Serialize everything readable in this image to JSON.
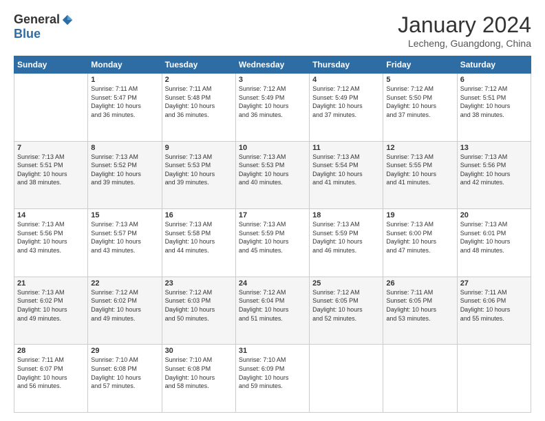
{
  "logo": {
    "general": "General",
    "blue": "Blue"
  },
  "title": "January 2024",
  "location": "Lecheng, Guangdong, China",
  "days_of_week": [
    "Sunday",
    "Monday",
    "Tuesday",
    "Wednesday",
    "Thursday",
    "Friday",
    "Saturday"
  ],
  "weeks": [
    [
      {
        "day": "",
        "info": ""
      },
      {
        "day": "1",
        "info": "Sunrise: 7:11 AM\nSunset: 5:47 PM\nDaylight: 10 hours\nand 36 minutes."
      },
      {
        "day": "2",
        "info": "Sunrise: 7:11 AM\nSunset: 5:48 PM\nDaylight: 10 hours\nand 36 minutes."
      },
      {
        "day": "3",
        "info": "Sunrise: 7:12 AM\nSunset: 5:49 PM\nDaylight: 10 hours\nand 36 minutes."
      },
      {
        "day": "4",
        "info": "Sunrise: 7:12 AM\nSunset: 5:49 PM\nDaylight: 10 hours\nand 37 minutes."
      },
      {
        "day": "5",
        "info": "Sunrise: 7:12 AM\nSunset: 5:50 PM\nDaylight: 10 hours\nand 37 minutes."
      },
      {
        "day": "6",
        "info": "Sunrise: 7:12 AM\nSunset: 5:51 PM\nDaylight: 10 hours\nand 38 minutes."
      }
    ],
    [
      {
        "day": "7",
        "info": "Sunrise: 7:13 AM\nSunset: 5:51 PM\nDaylight: 10 hours\nand 38 minutes."
      },
      {
        "day": "8",
        "info": "Sunrise: 7:13 AM\nSunset: 5:52 PM\nDaylight: 10 hours\nand 39 minutes."
      },
      {
        "day": "9",
        "info": "Sunrise: 7:13 AM\nSunset: 5:53 PM\nDaylight: 10 hours\nand 39 minutes."
      },
      {
        "day": "10",
        "info": "Sunrise: 7:13 AM\nSunset: 5:53 PM\nDaylight: 10 hours\nand 40 minutes."
      },
      {
        "day": "11",
        "info": "Sunrise: 7:13 AM\nSunset: 5:54 PM\nDaylight: 10 hours\nand 41 minutes."
      },
      {
        "day": "12",
        "info": "Sunrise: 7:13 AM\nSunset: 5:55 PM\nDaylight: 10 hours\nand 41 minutes."
      },
      {
        "day": "13",
        "info": "Sunrise: 7:13 AM\nSunset: 5:56 PM\nDaylight: 10 hours\nand 42 minutes."
      }
    ],
    [
      {
        "day": "14",
        "info": "Sunrise: 7:13 AM\nSunset: 5:56 PM\nDaylight: 10 hours\nand 43 minutes."
      },
      {
        "day": "15",
        "info": "Sunrise: 7:13 AM\nSunset: 5:57 PM\nDaylight: 10 hours\nand 43 minutes."
      },
      {
        "day": "16",
        "info": "Sunrise: 7:13 AM\nSunset: 5:58 PM\nDaylight: 10 hours\nand 44 minutes."
      },
      {
        "day": "17",
        "info": "Sunrise: 7:13 AM\nSunset: 5:59 PM\nDaylight: 10 hours\nand 45 minutes."
      },
      {
        "day": "18",
        "info": "Sunrise: 7:13 AM\nSunset: 5:59 PM\nDaylight: 10 hours\nand 46 minutes."
      },
      {
        "day": "19",
        "info": "Sunrise: 7:13 AM\nSunset: 6:00 PM\nDaylight: 10 hours\nand 47 minutes."
      },
      {
        "day": "20",
        "info": "Sunrise: 7:13 AM\nSunset: 6:01 PM\nDaylight: 10 hours\nand 48 minutes."
      }
    ],
    [
      {
        "day": "21",
        "info": "Sunrise: 7:13 AM\nSunset: 6:02 PM\nDaylight: 10 hours\nand 49 minutes."
      },
      {
        "day": "22",
        "info": "Sunrise: 7:12 AM\nSunset: 6:02 PM\nDaylight: 10 hours\nand 49 minutes."
      },
      {
        "day": "23",
        "info": "Sunrise: 7:12 AM\nSunset: 6:03 PM\nDaylight: 10 hours\nand 50 minutes."
      },
      {
        "day": "24",
        "info": "Sunrise: 7:12 AM\nSunset: 6:04 PM\nDaylight: 10 hours\nand 51 minutes."
      },
      {
        "day": "25",
        "info": "Sunrise: 7:12 AM\nSunset: 6:05 PM\nDaylight: 10 hours\nand 52 minutes."
      },
      {
        "day": "26",
        "info": "Sunrise: 7:11 AM\nSunset: 6:05 PM\nDaylight: 10 hours\nand 53 minutes."
      },
      {
        "day": "27",
        "info": "Sunrise: 7:11 AM\nSunset: 6:06 PM\nDaylight: 10 hours\nand 55 minutes."
      }
    ],
    [
      {
        "day": "28",
        "info": "Sunrise: 7:11 AM\nSunset: 6:07 PM\nDaylight: 10 hours\nand 56 minutes."
      },
      {
        "day": "29",
        "info": "Sunrise: 7:10 AM\nSunset: 6:08 PM\nDaylight: 10 hours\nand 57 minutes."
      },
      {
        "day": "30",
        "info": "Sunrise: 7:10 AM\nSunset: 6:08 PM\nDaylight: 10 hours\nand 58 minutes."
      },
      {
        "day": "31",
        "info": "Sunrise: 7:10 AM\nSunset: 6:09 PM\nDaylight: 10 hours\nand 59 minutes."
      },
      {
        "day": "",
        "info": ""
      },
      {
        "day": "",
        "info": ""
      },
      {
        "day": "",
        "info": ""
      }
    ]
  ]
}
